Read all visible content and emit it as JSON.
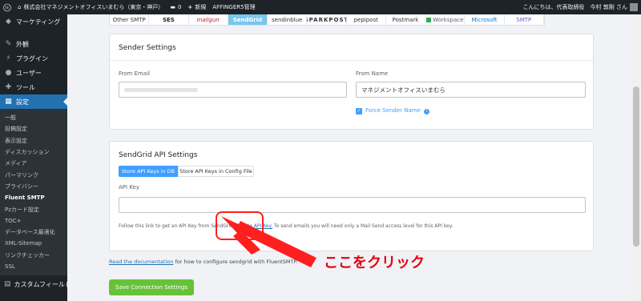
{
  "adminbar": {
    "site_name": "株式会社マネジメントオフィスいまむら（東京・神戸）",
    "comments_count": "0",
    "new_label": "新規",
    "affinger_label": "AFFINGER5管理",
    "greeting": "こんにちは、代表取締役　今村 敦剛 さん"
  },
  "sidebar": {
    "top_items": [
      {
        "label": "マーケティング",
        "icon": "megaphone-icon"
      },
      {
        "label": "外観",
        "icon": "paintbrush-icon"
      },
      {
        "label": "プラグイン",
        "icon": "plugin-icon"
      },
      {
        "label": "ユーザー",
        "icon": "users-icon"
      },
      {
        "label": "ツール",
        "icon": "wrench-icon"
      },
      {
        "label": "設定",
        "icon": "settings-icon"
      }
    ],
    "sub_items": [
      "一般",
      "投稿設定",
      "表示設定",
      "ディスカッション",
      "メディア",
      "パーマリンク",
      "プライバシー",
      "Fluent SMTP",
      "Pzカード設定",
      "TOC+",
      "データベース最適化",
      "XML-Sitemap",
      "リンクチェッカー",
      "SSL"
    ],
    "bottom_item": {
      "label": "カスタムフィールド",
      "icon": "grid-icon"
    }
  },
  "providers": [
    {
      "label": "Other SMTP",
      "key": "other"
    },
    {
      "label": "SES",
      "key": "ses"
    },
    {
      "label": "mailgun",
      "key": "mailgun"
    },
    {
      "label": "SendGrid",
      "key": "sendgrid"
    },
    {
      "label": "sendinblue",
      "key": "sendinblue"
    },
    {
      "label": "SPARKPOST",
      "key": "sparkpost"
    },
    {
      "label": "pepipost",
      "key": "pepipost"
    },
    {
      "label": "Postmark",
      "key": "postmark"
    },
    {
      "label": "Workspace",
      "key": "workspace"
    },
    {
      "label": "Microsoft",
      "key": "microsoft"
    },
    {
      "label": "SMTP",
      "key": "wpsmtp"
    }
  ],
  "sender": {
    "title": "Sender Settings",
    "from_email_label": "From Email",
    "from_name_label": "From Name",
    "from_name_value": "マネジメントオフィスいまむら",
    "force_label": "Force Sender Name"
  },
  "api": {
    "title": "SendGrid API Settings",
    "tab_db": "Store API Keys in DB",
    "tab_config": "Store API Keys in Config File",
    "key_label": "API Key",
    "help_prefix": "Follow this link to get an API Key from SendGrid: ",
    "help_link": "Create API Key.",
    "help_suffix": " To send emails you will need only a Mail Send access level for this API key."
  },
  "doc": {
    "link": "Read the documentation",
    "suffix": " for how to configure sendgrid with FluentSMTP."
  },
  "save_label": "Save Connection Settings",
  "annotation": {
    "text": "ここをクリック",
    "color": "#e60012"
  }
}
